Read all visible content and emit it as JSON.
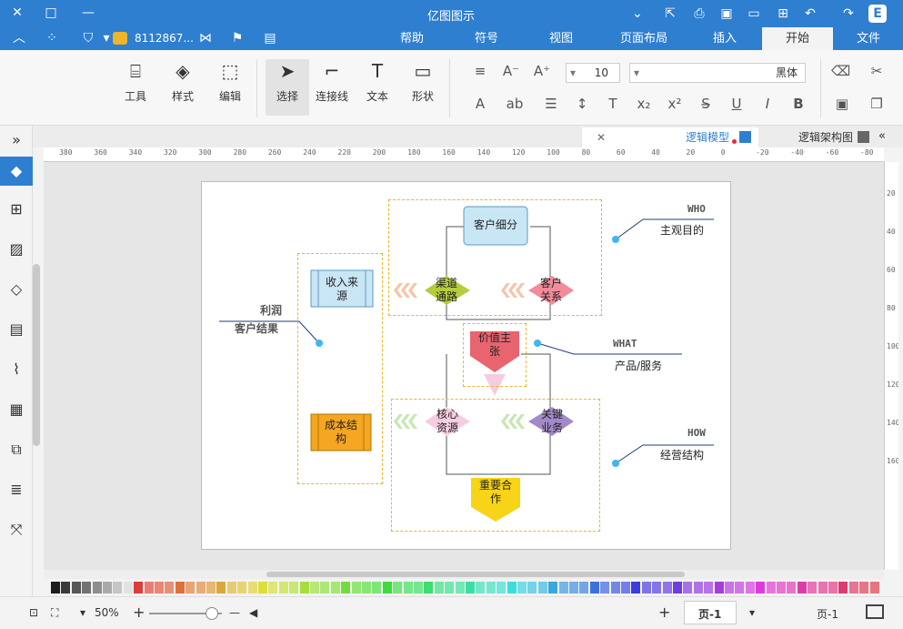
{
  "titlebar": {
    "title": "亿图图示",
    "logo": "E"
  },
  "menubar": {
    "tabs": [
      "文件",
      "开始",
      "插入",
      "页面布局",
      "视图",
      "符号",
      "帮助"
    ],
    "active_tab": "开始",
    "account": "811286​7...",
    "dropdown_marker": "▾"
  },
  "ribbon": {
    "tools_label": "工具",
    "style_label": "样式",
    "edit_label": "编辑",
    "select_label": "选择",
    "connector_label": "连接线",
    "text_label": "文本",
    "shape_label": "形状",
    "font_name": "黑体",
    "font_size": "10"
  },
  "doctabs": {
    "tab1": "逻辑架构图",
    "tab2": "逻辑模型"
  },
  "ruler_h": [
    "-80",
    "-60",
    "-40",
    "-20",
    "0",
    "20",
    "40",
    "60",
    "80",
    "100",
    "120",
    "140",
    "160",
    "180",
    "200",
    "220",
    "240",
    "260",
    "280",
    "300",
    "320",
    "340",
    "360",
    "380"
  ],
  "ruler_v": [
    "20",
    "40",
    "60",
    "80",
    "100",
    "120",
    "140",
    "160"
  ],
  "diagram": {
    "customer_segment": "客户细分",
    "customer_relation": "客户\n关系",
    "channel": "渠道\n通路",
    "revenue": "收入来\n源",
    "value_prop": "价值主\n张",
    "key_activity": "关键\n业务",
    "key_resource": "核心\n资源",
    "cost": "成本结\n构",
    "partners": "重要合\n作",
    "who_title": "WHO",
    "who_desc": "主观目的",
    "what_title": "WHAT",
    "what_desc": "产品/服务",
    "how_title": "HOW",
    "how_desc": "经营结构",
    "profit_title": "利润",
    "profit_desc": "客户结果"
  },
  "status": {
    "page_tab": "页-1",
    "page_current": "页-1",
    "add": "+",
    "zoom": "50%"
  },
  "colors": {
    "brand": "#2f7fd0",
    "dash": "#f0b429",
    "pink": "#f28b9a",
    "olive": "#b6cc3c",
    "red": "#e8646e",
    "purple": "#a38ac9",
    "lightpink": "#f6cde0",
    "orange": "#f5a623",
    "yellow": "#f7d417",
    "lightblue": "#c9e6f4"
  }
}
